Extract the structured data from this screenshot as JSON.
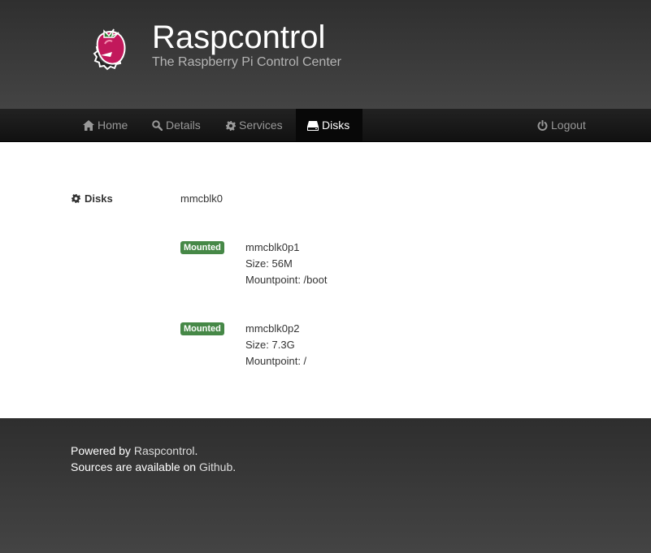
{
  "header": {
    "title": "Raspcontrol",
    "subtitle": "The Raspberry Pi Control Center"
  },
  "nav": {
    "items": [
      {
        "label": "Home",
        "icon": "home-icon"
      },
      {
        "label": "Details",
        "icon": "search-icon"
      },
      {
        "label": "Services",
        "icon": "gear-icon"
      },
      {
        "label": "Disks",
        "icon": "hdd-icon",
        "active": true
      }
    ],
    "logout": {
      "label": "Logout",
      "icon": "power-icon"
    }
  },
  "disks": {
    "section_label": "Disks",
    "disk_name": "mmcblk0",
    "partitions": [
      {
        "badge": "Mounted",
        "name": "mmcblk0p1",
        "size": "Size: 56M",
        "mountpoint": "Mountpoint: /boot"
      },
      {
        "badge": "Mounted",
        "name": "mmcblk0p2",
        "size": "Size: 7.3G",
        "mountpoint": "Mountpoint: /"
      }
    ]
  },
  "footer": {
    "powered_prefix": "Powered by ",
    "powered_link": "Raspcontrol",
    "powered_suffix": ".",
    "sources_prefix": "Sources are available on ",
    "sources_link": "Github",
    "sources_suffix": "."
  },
  "colors": {
    "badge_success": "#468847",
    "logo_berry": "#c2185b",
    "navbar_active": "#080808"
  }
}
